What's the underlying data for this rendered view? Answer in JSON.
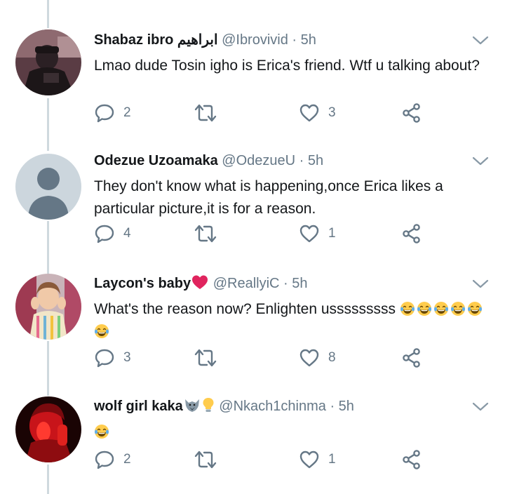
{
  "tweets": [
    {
      "name": "Shabaz ibro ابراهيم",
      "handle": "@Ibrovivid",
      "separator": "·",
      "time": "5h",
      "text": "Lmao dude Tosin igho is Erica's friend. Wtf u talking about?",
      "emojis_after_text": 0,
      "replies": "2",
      "retweets": "",
      "likes": "3",
      "avatar_icon": "person-avatar-dark"
    },
    {
      "name": "Odezue Uzoamaka",
      "handle": "@OdezueU",
      "separator": "·",
      "time": "5h",
      "text": "They don't know what is happening,once Erica likes a particular picture,it is for a reason.",
      "emojis_after_text": 0,
      "replies": "4",
      "retweets": "",
      "likes": "1",
      "avatar_icon": "default-avatar"
    },
    {
      "name": "Laycon's baby",
      "name_icon": "red-heart-icon",
      "handle": "@ReallyiC",
      "separator": "·",
      "time": "5h",
      "text": "What's the reason now? Enlighten usssssssss",
      "emojis_after_text": 6,
      "emoji_icon": "laughing-tears-emoji",
      "replies": "3",
      "retweets": "",
      "likes": "8",
      "avatar_icon": "child-avatar"
    },
    {
      "name": "wolf girl kaka",
      "name_icon": "wolf-and-bulb-icons",
      "handle": "@Nkach1chinma",
      "separator": "·",
      "time": "5h",
      "text": "",
      "emojis_after_text": 1,
      "emoji_icon": "laughing-tears-emoji",
      "replies": "2",
      "retweets": "",
      "likes": "1",
      "avatar_icon": "red-lit-avatar"
    }
  ],
  "colors": {
    "text": "#14171a",
    "secondary": "#657786",
    "thread_line": "#cfd9de",
    "heart": "#e0245e"
  }
}
